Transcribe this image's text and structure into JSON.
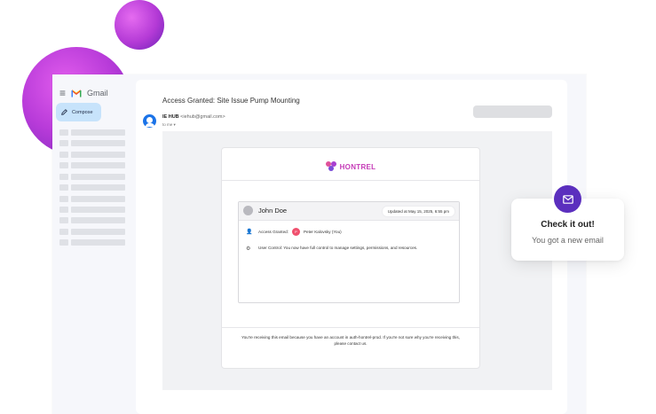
{
  "gmail": {
    "title": "Gmail",
    "compose_label": "Compose"
  },
  "email": {
    "subject": "Access Granted: Site Issue Pump Mounting",
    "sender_name": "IE HUB",
    "sender_email": "<iehub@gmail.com>",
    "to": "to me"
  },
  "card": {
    "brand": "HONTREL",
    "user_name": "John Doe",
    "updated": "Updated at May 15, 2025, 6:55 pm",
    "access_label": "Access Granted:",
    "grantee_initial": "P",
    "grantee": "Peter Kalovsky (You)",
    "control_text": "User Control: You now have full control to manage settings, permissions, and resources.",
    "footer": "You're receiving this email because you have an account in auth-hontrel-prod. If you're not sure why you're receiving this, please contact us."
  },
  "toast": {
    "title": "Check it out!",
    "body": "You got a new email"
  },
  "colors": {
    "accent_purple": "#5b2fbe",
    "brand_pink": "#c53bb7",
    "compose_blue": "#c7e3fb",
    "grantee_red": "#f0506e"
  },
  "icons": [
    "hamburger-icon",
    "gmail-logo-icon",
    "pencil-icon",
    "user-add-icon",
    "gear-icon",
    "mail-icon"
  ]
}
